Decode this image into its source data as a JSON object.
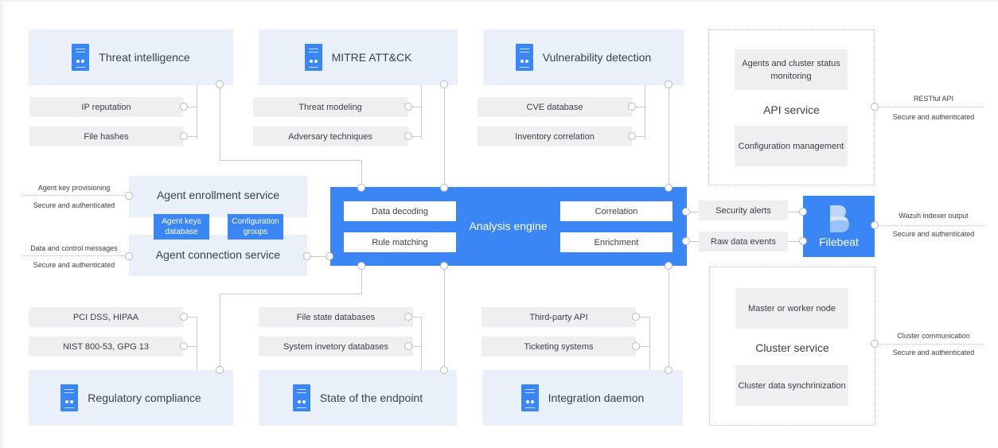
{
  "modules": {
    "threat_intelligence": {
      "title": "Threat intelligence",
      "icon": "server-icon",
      "items": [
        "IP reputation",
        "File hashes"
      ]
    },
    "mitre": {
      "title": "MITRE ATT&CK",
      "icon": "server-icon",
      "items": [
        "Threat modeling",
        "Adversary techniques"
      ]
    },
    "vulnerability": {
      "title": "Vulnerability detection",
      "icon": "server-icon",
      "items": [
        "CVE database",
        "Inventory correlation"
      ]
    },
    "regulatory": {
      "title": "Regulatory compliance",
      "icon": "server-icon",
      "items": [
        "PCI DSS, HIPAA",
        "NIST 800-53, GPG 13"
      ]
    },
    "endpoint": {
      "title": "State of the endpoint",
      "icon": "server-icon",
      "items": [
        "File state databases",
        "System invetory databases"
      ]
    },
    "integration": {
      "title": "Integration daemon",
      "icon": "server-icon",
      "items": [
        "Third-party API",
        "Ticketing systems"
      ]
    }
  },
  "agent": {
    "enrollment_title": "Agent enrollment service",
    "connection_title": "Agent connection service",
    "keys_db": "Agent keys database",
    "config_groups": "Configuration groups",
    "enrollment_label_top": "Agent key provisioning",
    "enrollment_label_bottom": "Secure and authenticated",
    "connection_label_top": "Data and control messages",
    "connection_label_bottom": "Secure and authenticated"
  },
  "engine": {
    "title": "Analysis engine",
    "left": [
      "Data decoding",
      "Rule matching"
    ],
    "right": [
      "Correlation",
      "Enrichment"
    ]
  },
  "outputs": {
    "alerts": "Security alerts",
    "raw": "Raw data events"
  },
  "filebeat": {
    "title": "Filebeat",
    "label_top": "Wazuh indexer output",
    "label_bottom": "Secure and authenticated"
  },
  "api_service": {
    "title": "API service",
    "items": [
      "Agents and cluster status monitoring",
      "Configuration management"
    ],
    "label_top": "RESTful API",
    "label_bottom": "Secure and authenticated"
  },
  "cluster_service": {
    "title": "Cluster service",
    "items": [
      "Master or worker node",
      "Cluster data synchrinization"
    ],
    "label_top": "Cluster communication",
    "label_bottom": "Secure and authenticated"
  },
  "colors": {
    "accent": "#3a86f4",
    "module_bg": "#eaf0fa",
    "sub_bg": "#efeef1"
  }
}
